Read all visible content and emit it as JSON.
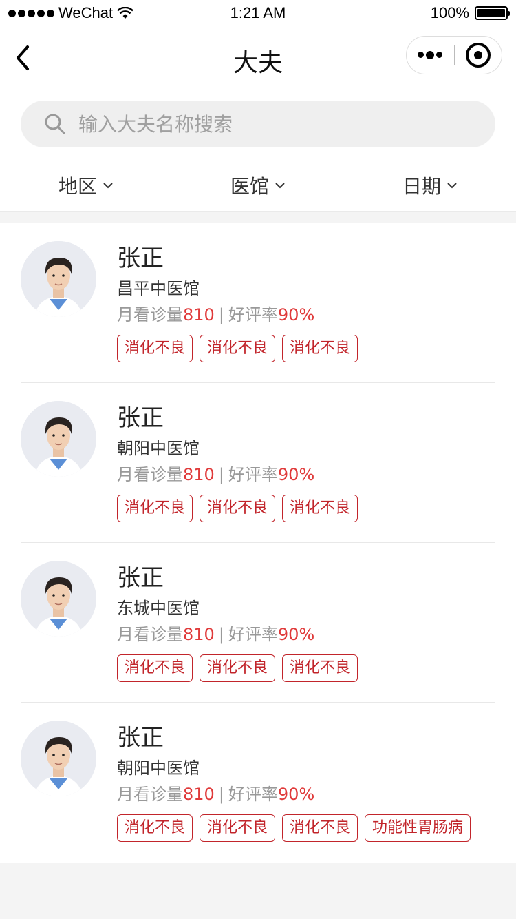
{
  "status_bar": {
    "carrier": "WeChat",
    "time": "1:21 AM",
    "battery": "100%"
  },
  "nav": {
    "title": "大夫"
  },
  "search": {
    "placeholder": "输入大夫名称搜索"
  },
  "filters": [
    {
      "label": "地区"
    },
    {
      "label": "医馆"
    },
    {
      "label": "日期"
    }
  ],
  "doctors": [
    {
      "name": "张正",
      "hospital": "昌平中医馆",
      "visits_label": "月看诊量",
      "visits": "810",
      "rating_label": "好评率",
      "rating": "90%",
      "tags": [
        "消化不良",
        "消化不良",
        "消化不良"
      ]
    },
    {
      "name": "张正",
      "hospital": "朝阳中医馆",
      "visits_label": "月看诊量",
      "visits": "810",
      "rating_label": "好评率",
      "rating": "90%",
      "tags": [
        "消化不良",
        "消化不良",
        "消化不良"
      ]
    },
    {
      "name": "张正",
      "hospital": "东城中医馆",
      "visits_label": "月看诊量",
      "visits": "810",
      "rating_label": "好评率",
      "rating": "90%",
      "tags": [
        "消化不良",
        "消化不良",
        "消化不良"
      ]
    },
    {
      "name": "张正",
      "hospital": "朝阳中医馆",
      "visits_label": "月看诊量",
      "visits": "810",
      "rating_label": "好评率",
      "rating": "90%",
      "tags": [
        "消化不良",
        "消化不良",
        "消化不良",
        "功能性胃肠病"
      ]
    }
  ],
  "colors": {
    "accent_red": "#c2252b",
    "stat_red": "#e03a3a"
  }
}
